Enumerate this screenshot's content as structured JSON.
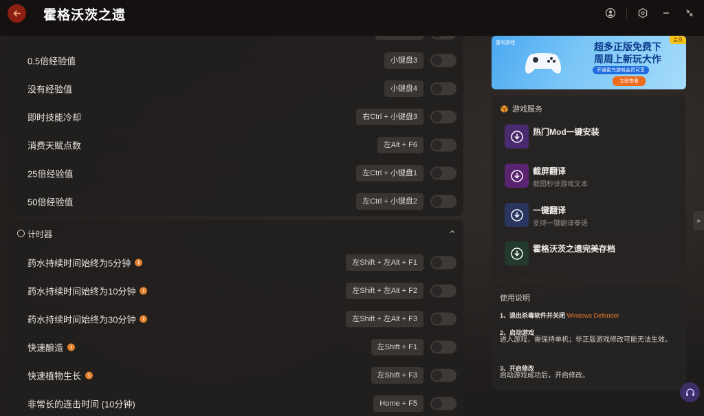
{
  "window": {
    "title": "霍格沃茨之遗"
  },
  "cheats_section1": {
    "rows": [
      {
        "label": "0.5倍经验值",
        "hotkey": "小键盘3"
      },
      {
        "label": "没有经验值",
        "hotkey": "小键盘4"
      },
      {
        "label": "即时技能冷却",
        "hotkey": "右Ctrl + 小键盘3"
      },
      {
        "label": "消费天赋点数",
        "hotkey": "左Alt + F6"
      },
      {
        "label": "25倍经验值",
        "hotkey": "左Ctrl + 小键盘1"
      },
      {
        "label": "50倍经验值",
        "hotkey": "左Ctrl + 小键盘2"
      }
    ]
  },
  "timer_section": {
    "title": "计时器",
    "rows": [
      {
        "label": "药水持续时间始终为5分钟",
        "hotkey": "左Shift + 左Alt + F1"
      },
      {
        "label": "药水持续时间始终为10分钟",
        "hotkey": "左Shift + 左Alt + F2"
      },
      {
        "label": "药水持续时间始终为30分钟",
        "hotkey": "左Shift + 左Alt + F3"
      },
      {
        "label": "快速酿造",
        "hotkey": "左Shift + F1"
      },
      {
        "label": "快速植物生长",
        "hotkey": "左Shift + F3"
      },
      {
        "label": "非常长的连击时间 (10分钟)",
        "hotkey": "Home + F5"
      }
    ]
  },
  "banner": {
    "brand": "雷鸟游戏",
    "corner": "会员",
    "headline1": "超多正版免费下",
    "headline2": "周周上新玩大作",
    "tagline": "开通雷鸟游戏会员可享",
    "cta": "立即查看"
  },
  "services": {
    "title": "游戏服务",
    "items": [
      {
        "title": "热门Mod一键安装",
        "subtitle": "",
        "color": "#4a2a6e"
      },
      {
        "title": "截屏翻译",
        "subtitle": "截图秒译游戏文本",
        "color": "#5a2470"
      },
      {
        "title": "一键翻译",
        "subtitle": "支持一键翻译泰语",
        "color": "#2a3560"
      },
      {
        "title": "霍格沃茨之遗完美存档",
        "subtitle": "",
        "color": "#243a2e"
      }
    ]
  },
  "help": {
    "title": "使用说明",
    "step1": "1、退出杀毒软件并关闭",
    "step1_link": "Windows Defender",
    "step2": "2、启动游戏",
    "step2_text": "进入游戏，需保持单机；非正版游戏修改可能无法生效。",
    "step3": "3、开启修改",
    "step3_text": "启动游戏成功后，开启修改。"
  },
  "colors": {
    "accent": "#e77a2a",
    "back_button": "#8a1f12"
  }
}
